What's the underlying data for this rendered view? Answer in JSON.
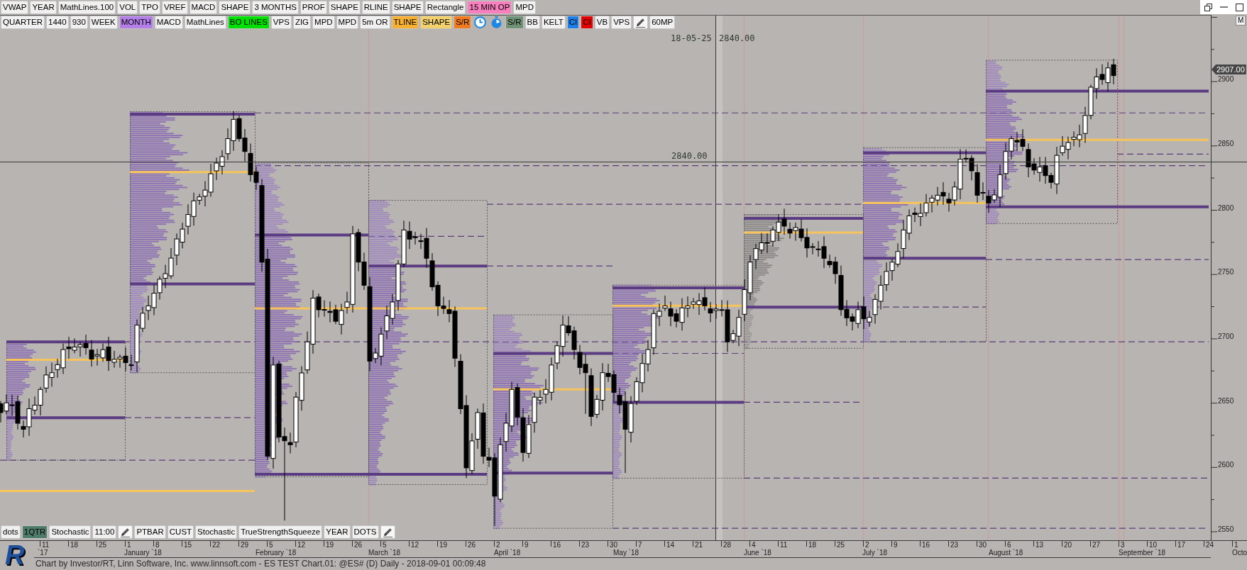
{
  "toolbar_top": [
    {
      "kind": "button",
      "label": "VWAP"
    },
    {
      "kind": "button",
      "label": "YEAR"
    },
    {
      "kind": "button",
      "label": "MathLines.100"
    },
    {
      "kind": "button",
      "label": "VOL"
    },
    {
      "kind": "button",
      "label": "TPO"
    },
    {
      "kind": "button",
      "label": "VREF"
    },
    {
      "kind": "button",
      "label": "MACD"
    },
    {
      "kind": "button",
      "label": "SHAPE"
    },
    {
      "kind": "button",
      "label": "3 MONTHS"
    },
    {
      "kind": "button",
      "label": "PROF"
    },
    {
      "kind": "button",
      "label": "SHAPE"
    },
    {
      "kind": "button",
      "label": "RLINE"
    },
    {
      "kind": "button",
      "label": "SHAPE"
    },
    {
      "kind": "button",
      "label": "Rectangle"
    },
    {
      "kind": "button",
      "label": "15 MIN OP",
      "color": "#f77fbe"
    },
    {
      "kind": "button",
      "label": "MPD"
    }
  ],
  "toolbar_second": [
    {
      "kind": "button",
      "label": "QUARTER"
    },
    {
      "kind": "button",
      "label": "1440"
    },
    {
      "kind": "button",
      "label": "930"
    },
    {
      "kind": "button",
      "label": "WEEK"
    },
    {
      "kind": "button",
      "label": "MONTH",
      "color": "#b47ee8"
    },
    {
      "kind": "button",
      "label": "MACD"
    },
    {
      "kind": "button",
      "label": "MathLines"
    },
    {
      "kind": "button",
      "label": "BO LINES",
      "color": "#00e000"
    },
    {
      "kind": "button",
      "label": "VPS"
    },
    {
      "kind": "button",
      "label": "ZIG"
    },
    {
      "kind": "button",
      "label": "MPD"
    },
    {
      "kind": "button",
      "label": "MPD"
    },
    {
      "kind": "button",
      "label": "5m OR"
    },
    {
      "kind": "button",
      "label": "TLINE",
      "color": "#f7b032"
    },
    {
      "kind": "button",
      "label": "SHAPE",
      "color": "#f2d06b"
    },
    {
      "kind": "button",
      "label": "S/R",
      "color": "#f27a1e"
    },
    {
      "kind": "clock"
    },
    {
      "kind": "timer"
    },
    {
      "kind": "button",
      "label": "S/R",
      "color": "#6f9175"
    },
    {
      "kind": "button",
      "label": "BB"
    },
    {
      "kind": "button",
      "label": "KELT"
    },
    {
      "kind": "button",
      "label": "CI",
      "color": "#1c7ee6"
    },
    {
      "kind": "button",
      "label": "CI",
      "color": "#e50000"
    },
    {
      "kind": "button",
      "label": "VB"
    },
    {
      "kind": "button",
      "label": "VPS"
    },
    {
      "kind": "edit"
    },
    {
      "kind": "button",
      "label": "60MP"
    }
  ],
  "chart": {
    "crosshair_date": "18-05-25",
    "crosshair_price": "2840.00",
    "crosshair_level": "2840.00",
    "last_price": "2907.00",
    "scale_button": "M",
    "price_axis": [
      "2900",
      "2850",
      "2800",
      "2750",
      "2700",
      "2650",
      "2600",
      "2550"
    ]
  },
  "toolbar_bottom": [
    {
      "kind": "button",
      "label": "dots"
    },
    {
      "kind": "button",
      "label": "1QTR",
      "color": "#4f7c6a"
    },
    {
      "kind": "button",
      "label": "Stochastic"
    },
    {
      "kind": "button",
      "label": "11:00"
    },
    {
      "kind": "edit"
    },
    {
      "kind": "button",
      "label": "PTBAR"
    },
    {
      "kind": "button",
      "label": "CUST"
    },
    {
      "kind": "button",
      "label": "Stochastic"
    },
    {
      "kind": "button",
      "label": "TrueStrengthSqueeze"
    },
    {
      "kind": "button",
      "label": "YEAR"
    },
    {
      "kind": "button",
      "label": "DOTS"
    },
    {
      "kind": "edit"
    }
  ],
  "date_axis": {
    "days": [
      "11",
      "18",
      "25",
      "1",
      "8",
      "15",
      "22",
      "29",
      "5",
      "12",
      "19",
      "26",
      "5",
      "12",
      "19",
      "26",
      "2",
      "9",
      "16",
      "23",
      "30",
      "7",
      "14",
      "21",
      "28",
      "4",
      "11",
      "18",
      "25",
      "2",
      "9",
      "16",
      "23",
      "30",
      "6",
      "13",
      "20",
      "27",
      "3",
      "10",
      "17",
      "24",
      "1"
    ],
    "months": [
      "`17",
      "January `18",
      "February `18",
      "March `18",
      "April `18",
      "May `18",
      "June `18",
      "July `18",
      "August `18",
      "September `18",
      "Octo"
    ]
  },
  "logo": "R",
  "status_bar": "Chart by Investor/RT, Linn Software, Inc. www.linnsoft.com - ES TEST Chart.01: @ES# (D) Daily - 2018-09-01 00:09:48"
}
